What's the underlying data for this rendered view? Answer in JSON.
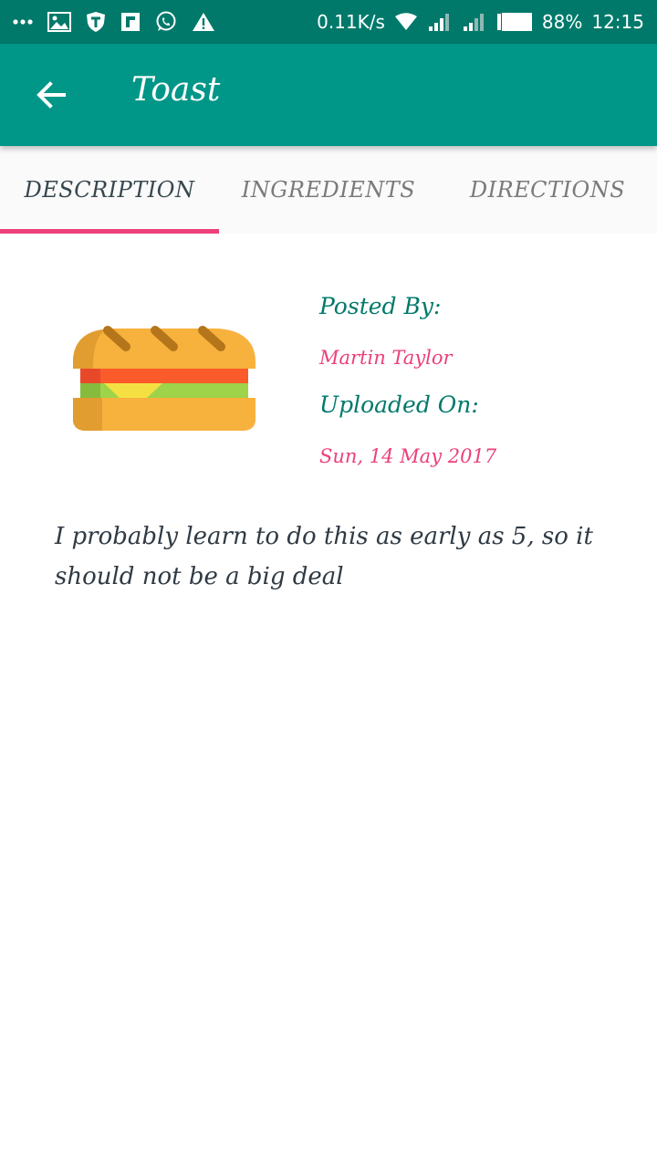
{
  "status_bar": {
    "network_speed": "0.11K/s",
    "battery_percent": "88%",
    "time": "12:15",
    "icons": [
      "more-dots-icon",
      "gallery-icon",
      "vpn-shield-icon",
      "flipboard-icon",
      "whatsapp-icon",
      "warning-icon",
      "wifi-icon",
      "signal-icon",
      "signal-icon",
      "battery-icon"
    ]
  },
  "app_bar": {
    "title": "Toast",
    "back_icon": "back-arrow-icon",
    "color": "#009688"
  },
  "tabs": [
    {
      "label": "DESCRIPTION",
      "active": true
    },
    {
      "label": "INGREDIENTS",
      "active": false
    },
    {
      "label": "DIRECTIONS",
      "active": false
    }
  ],
  "recipe": {
    "image_icon": "sandwich-icon",
    "posted_by_label": "Posted By:",
    "posted_by": "Martin Taylor",
    "uploaded_on_label": "Uploaded On:",
    "uploaded_on": "Sun, 14 May 2017",
    "description": "I probably learn to do this as early as 5, so it should not be a big deal"
  },
  "colors": {
    "status_bar": "#00796b",
    "primary": "#009688",
    "accent": "#ec407a",
    "label": "#00796b"
  }
}
